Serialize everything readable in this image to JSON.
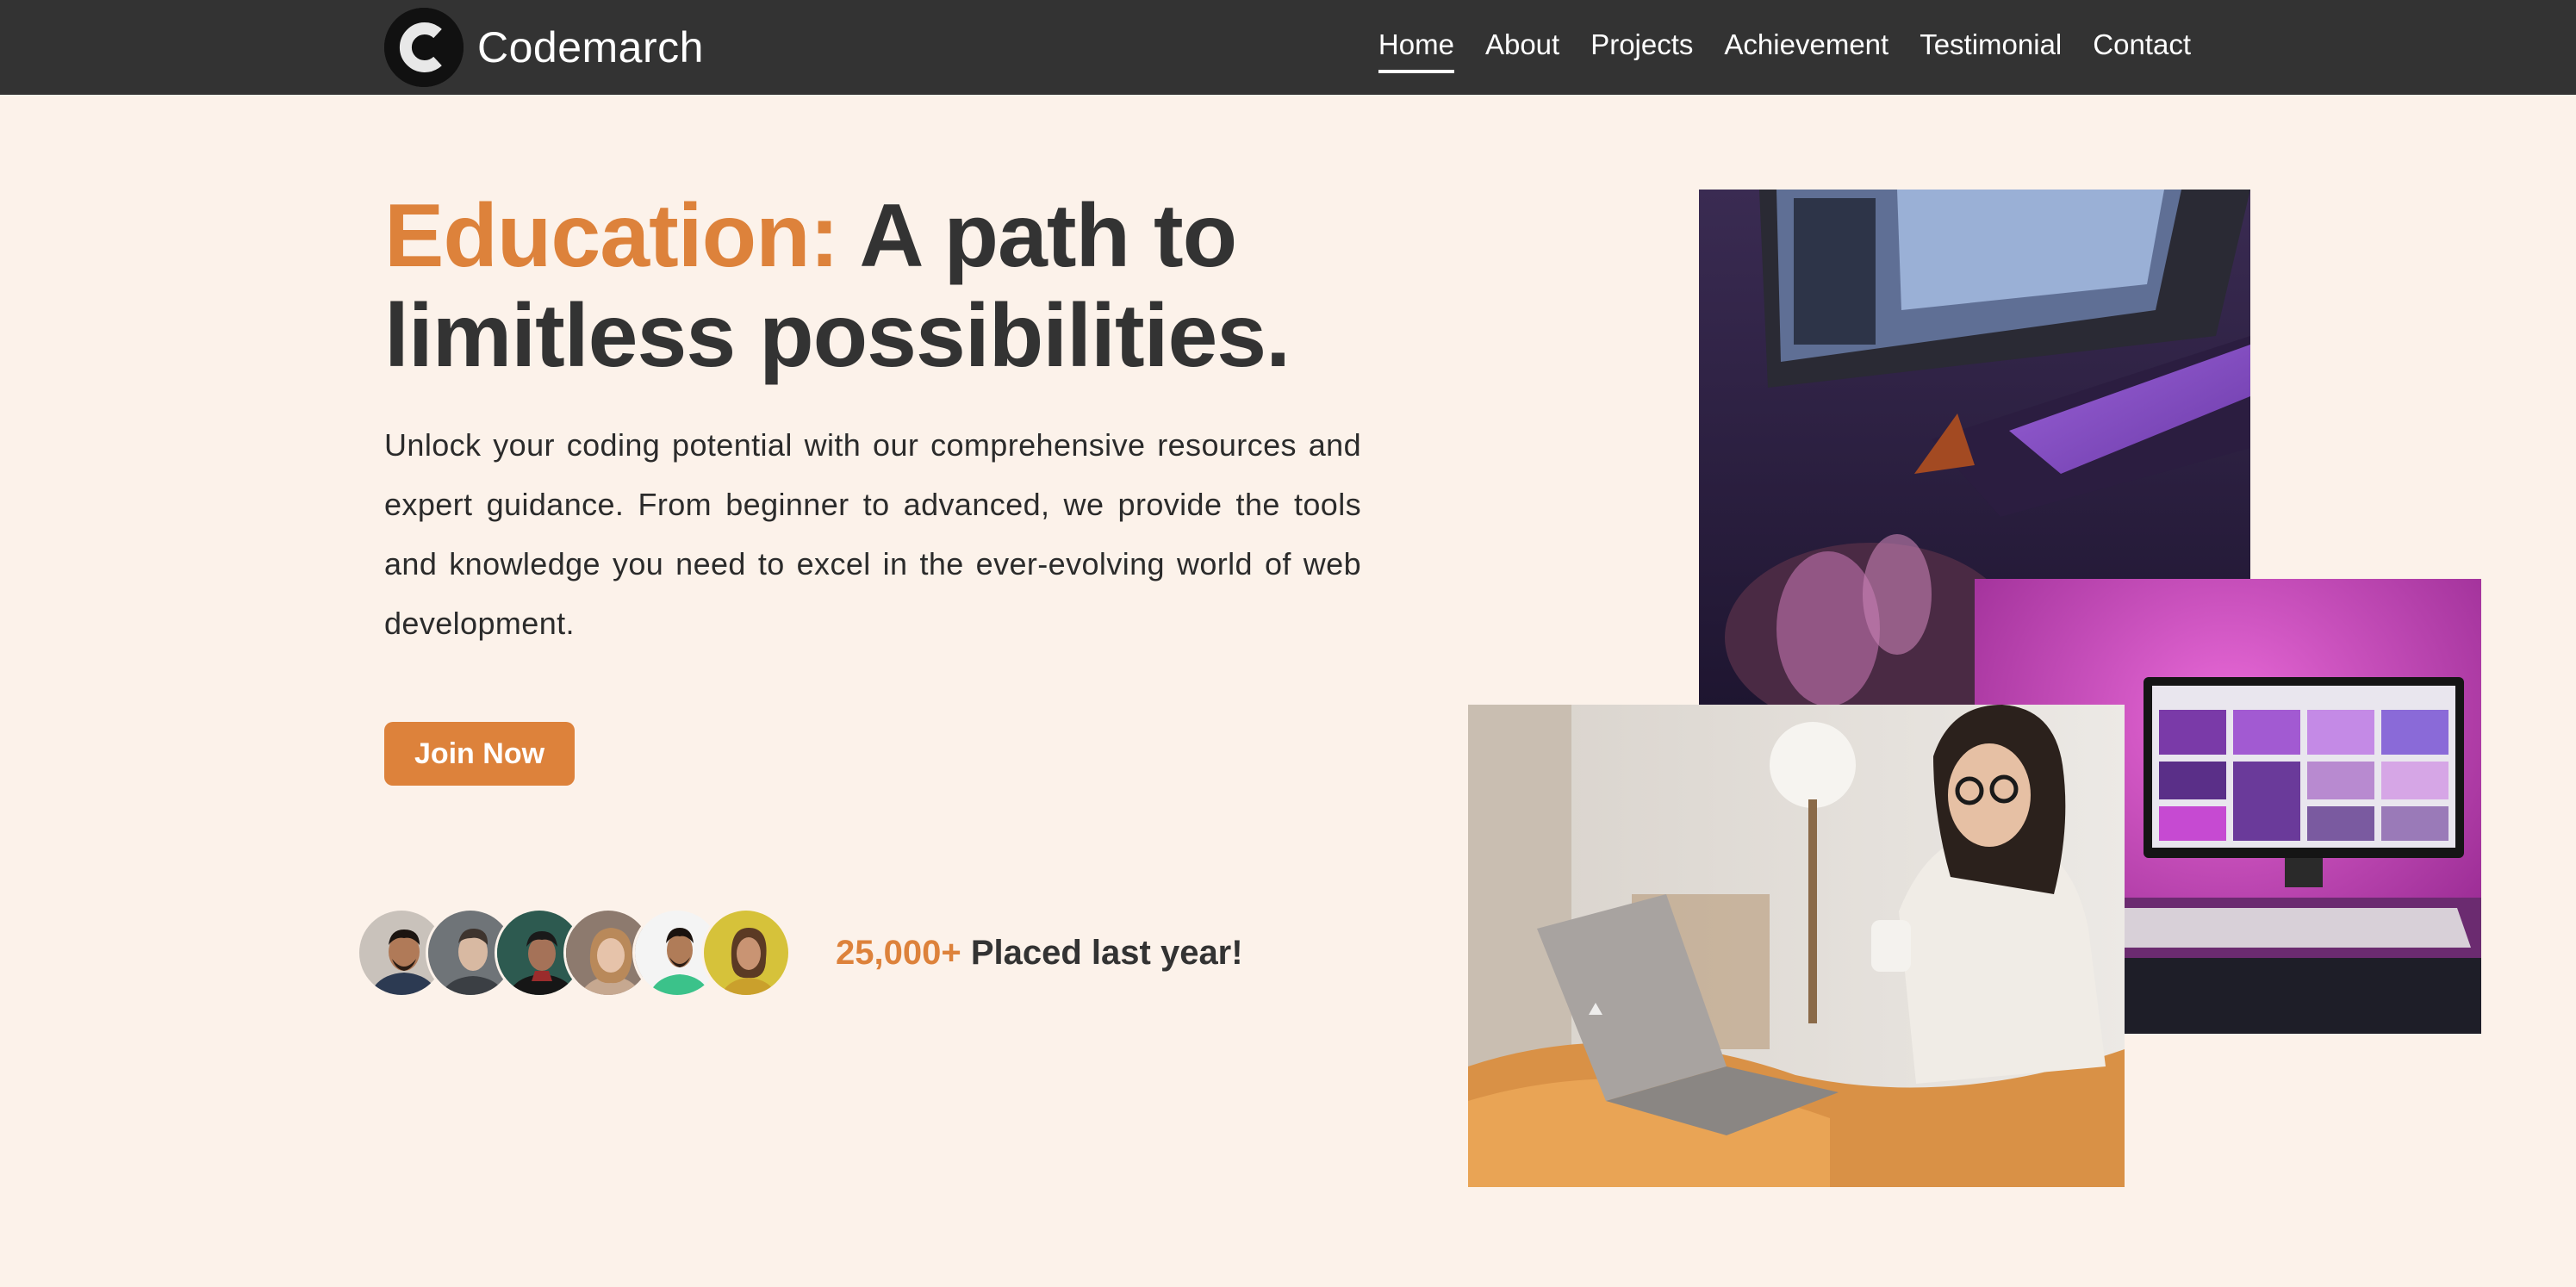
{
  "brand": {
    "name": "Codemarch",
    "logo_letter": "C"
  },
  "nav": {
    "items": [
      {
        "label": "Home",
        "active": true
      },
      {
        "label": "About"
      },
      {
        "label": "Projects"
      },
      {
        "label": "Achievement"
      },
      {
        "label": "Testimonial"
      },
      {
        "label": "Contact"
      }
    ]
  },
  "hero": {
    "title_accent": "Education:",
    "title_rest": "A path to limitless possibilities.",
    "description": "Unlock your coding potential with our comprehensive resources and expert guidance. From beginner to advanced, we provide the tools and knowledge you need to excel in the ever-evolving world of web development.",
    "cta_label": "Join Now"
  },
  "stats": {
    "number": "25,000+",
    "text": "Placed last year!"
  },
  "colors": {
    "accent": "#dd823b",
    "navbar": "#333333",
    "background": "#fcf2ea",
    "text": "#333333"
  }
}
